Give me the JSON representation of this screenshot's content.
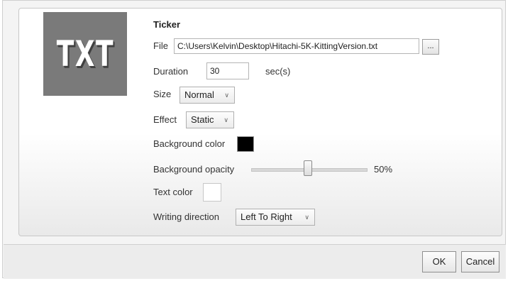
{
  "thumbnail": {
    "text": "TXT"
  },
  "section_title": "Ticker",
  "file": {
    "label": "File",
    "value": "C:\\Users\\Kelvin\\Desktop\\Hitachi-5K-KittingVersion.txt",
    "browse_label": "..."
  },
  "duration": {
    "label": "Duration",
    "value": "30",
    "unit": "sec(s)"
  },
  "size": {
    "label": "Size",
    "selected": "Normal"
  },
  "effect": {
    "label": "Effect",
    "selected": "Static"
  },
  "background_color": {
    "label": "Background color",
    "color": "#000000"
  },
  "background_opacity": {
    "label": "Background opacity",
    "value_text": "50%",
    "value": 0.5
  },
  "text_color": {
    "label": "Text color",
    "color": "#ffffff"
  },
  "writing_direction": {
    "label": "Writing direction",
    "selected": "Left To Right"
  },
  "buttons": {
    "ok": "OK",
    "cancel": "Cancel"
  }
}
